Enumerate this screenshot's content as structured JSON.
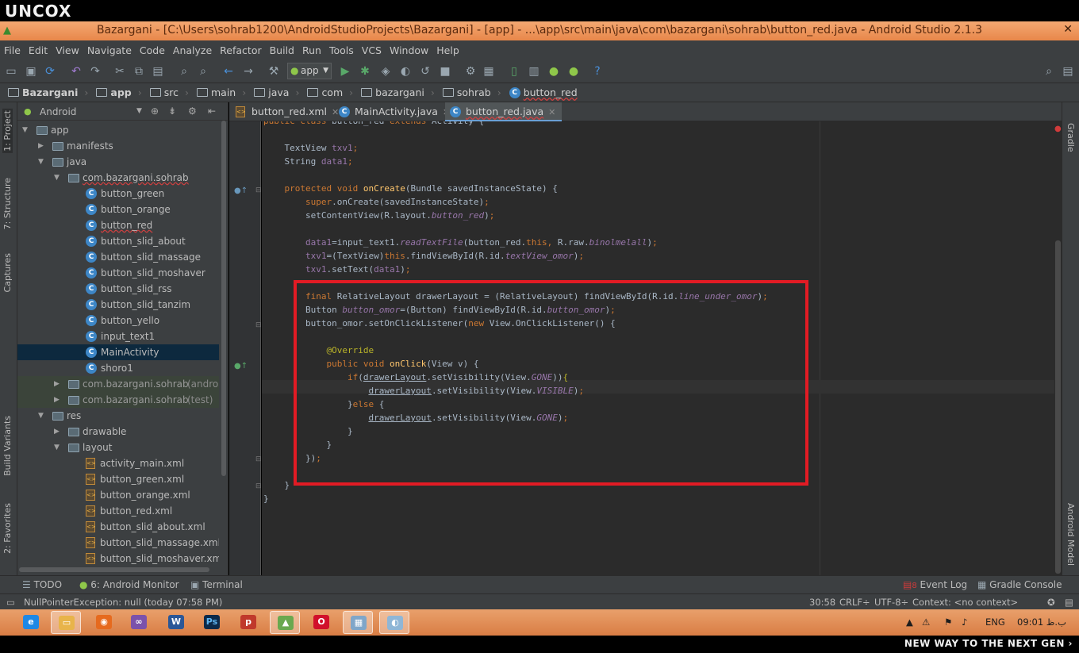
{
  "brand": {
    "logo": "UNCOX",
    "slogan": "NEW WAY TO THE NEXT GEN ›"
  },
  "window": {
    "title": "Bazargani - [C:\\Users\\sohrab1200\\AndroidStudioProjects\\Bazargani] - [app] - ...\\app\\src\\main\\java\\com\\bazargani\\sohrab\\button_red.java - Android Studio 2.1.3",
    "close": "✕"
  },
  "menu": [
    "File",
    "Edit",
    "View",
    "Navigate",
    "Code",
    "Analyze",
    "Refactor",
    "Build",
    "Run",
    "Tools",
    "VCS",
    "Window",
    "Help"
  ],
  "toolbar": {
    "run_config": "app"
  },
  "breadcrumbs": [
    "Bazargani",
    "app",
    "src",
    "main",
    "java",
    "com",
    "bazargani",
    "sohrab",
    "button_red"
  ],
  "left_stripe": {
    "project": "1: Project",
    "structure": "7: Structure",
    "captures": "Captures",
    "build_variants": "Build Variants",
    "favorites": "2: Favorites"
  },
  "right_stripe": {
    "gradle": "Gradle",
    "android_model": "Android Model"
  },
  "project_panel": {
    "view_mode": "Android",
    "tree": [
      {
        "label": "app",
        "type": "module",
        "indent": 0,
        "expanded": true
      },
      {
        "label": "manifests",
        "type": "folder",
        "indent": 1,
        "expanded": false
      },
      {
        "label": "java",
        "type": "folder",
        "indent": 1,
        "expanded": true
      },
      {
        "label": "com.bazargani.sohrab",
        "type": "package",
        "indent": 2,
        "expanded": true,
        "error": true
      },
      {
        "label": "button_green",
        "type": "class",
        "indent": 3
      },
      {
        "label": "button_orange",
        "type": "class",
        "indent": 3
      },
      {
        "label": "button_red",
        "type": "class",
        "indent": 3,
        "error": true
      },
      {
        "label": "button_slid_about",
        "type": "class",
        "indent": 3
      },
      {
        "label": "button_slid_massage",
        "type": "class",
        "indent": 3
      },
      {
        "label": "button_slid_moshaver",
        "type": "class",
        "indent": 3
      },
      {
        "label": "button_slid_rss",
        "type": "class",
        "indent": 3
      },
      {
        "label": "button_slid_tanzim",
        "type": "class",
        "indent": 3
      },
      {
        "label": "button_yello",
        "type": "class",
        "indent": 3
      },
      {
        "label": "input_text1",
        "type": "class",
        "indent": 3
      },
      {
        "label": "MainActivity",
        "type": "class",
        "indent": 3,
        "selected": true
      },
      {
        "label": "shoro1",
        "type": "class",
        "indent": 3
      },
      {
        "label": "com.bazargani.sohrab",
        "suffix": "(androidT",
        "type": "package",
        "indent": 2,
        "expanded": false,
        "gray": true
      },
      {
        "label": "com.bazargani.sohrab",
        "suffix": "(test)",
        "type": "package",
        "indent": 2,
        "expanded": false,
        "gray": true
      },
      {
        "label": "res",
        "type": "folder",
        "indent": 1,
        "expanded": true
      },
      {
        "label": "drawable",
        "type": "folder",
        "indent": 2,
        "expanded": false
      },
      {
        "label": "layout",
        "type": "folder",
        "indent": 2,
        "expanded": true
      },
      {
        "label": "activity_main.xml",
        "type": "xml",
        "indent": 3
      },
      {
        "label": "button_green.xml",
        "type": "xml",
        "indent": 3
      },
      {
        "label": "button_orange.xml",
        "type": "xml",
        "indent": 3
      },
      {
        "label": "button_red.xml",
        "type": "xml",
        "indent": 3
      },
      {
        "label": "button_slid_about.xml",
        "type": "xml",
        "indent": 3
      },
      {
        "label": "button_slid_massage.xml",
        "type": "xml",
        "indent": 3
      },
      {
        "label": "button_slid_moshaver.xml",
        "type": "xml",
        "indent": 3
      }
    ]
  },
  "editor_tabs": [
    {
      "label": "button_red.xml",
      "type": "xml",
      "active": false
    },
    {
      "label": "MainActivity.java",
      "type": "class",
      "active": false
    },
    {
      "label": "button_red.java",
      "type": "class",
      "active": true,
      "error": true
    }
  ],
  "code_lines": [
    {
      "line": "public class button_red extends Activity {",
      "spans": [
        [
          "kw",
          "public class "
        ],
        [
          "",
          "button_red "
        ],
        [
          "kw",
          "extends "
        ],
        [
          "",
          "Activity {"
        ]
      ]
    },
    {
      "spans": [
        [
          "",
          ""
        ]
      ]
    },
    {
      "spans": [
        [
          "",
          "    TextView "
        ],
        [
          "fd",
          "txv1"
        ],
        [
          "kw",
          ";"
        ]
      ]
    },
    {
      "spans": [
        [
          "",
          "    String "
        ],
        [
          "fd",
          "data1"
        ],
        [
          "kw",
          ";"
        ]
      ]
    },
    {
      "spans": [
        [
          "",
          ""
        ]
      ]
    },
    {
      "spans": [
        [
          "kw",
          "    protected void "
        ],
        [
          "fn",
          "onCreate"
        ],
        [
          "",
          "(Bundle savedInstanceState) {"
        ]
      ]
    },
    {
      "spans": [
        [
          "kw",
          "        super"
        ],
        [
          "",
          ".onCreate(savedInstanceState)"
        ],
        [
          "kw",
          ";"
        ]
      ]
    },
    {
      "spans": [
        [
          "",
          "        setContentView(R.layout."
        ],
        [
          "it",
          "button_red"
        ],
        [
          "",
          ")"
        ],
        [
          "kw",
          ";"
        ]
      ]
    },
    {
      "spans": [
        [
          "",
          ""
        ]
      ]
    },
    {
      "spans": [
        [
          "fd",
          "        data1"
        ],
        [
          "",
          "=input_text1."
        ],
        [
          "it",
          "readTextFile"
        ],
        [
          "",
          "(button_red."
        ],
        [
          "kw",
          "this, "
        ],
        [
          "",
          "R.raw."
        ],
        [
          "it",
          "binolmelall"
        ],
        [
          "",
          ")"
        ],
        [
          "kw",
          ";"
        ]
      ]
    },
    {
      "spans": [
        [
          "fd",
          "        txv1"
        ],
        [
          "",
          "=(TextView)"
        ],
        [
          "kw",
          "this"
        ],
        [
          "",
          ".findViewById(R.id."
        ],
        [
          "it",
          "textView_omor"
        ],
        [
          "",
          ")"
        ],
        [
          "kw",
          ";"
        ]
      ]
    },
    {
      "spans": [
        [
          "fd",
          "        txv1"
        ],
        [
          "",
          ".setText("
        ],
        [
          "fd",
          "data1"
        ],
        [
          "",
          ")"
        ],
        [
          "kw",
          ";"
        ]
      ]
    },
    {
      "spans": [
        [
          "",
          ""
        ]
      ]
    },
    {
      "spans": [
        [
          "kw",
          "        final "
        ],
        [
          "",
          "RelativeLayout drawerLayout = (RelativeLayout) findViewById(R.id."
        ],
        [
          "it",
          "line_under_omor"
        ],
        [
          "",
          ")"
        ],
        [
          "kw",
          ";"
        ]
      ]
    },
    {
      "spans": [
        [
          "",
          "        Button "
        ],
        [
          "it",
          "button_omor"
        ],
        [
          "",
          "=(Button) findViewById(R.id."
        ],
        [
          "it",
          "button_omor"
        ],
        [
          "",
          ")"
        ],
        [
          "kw",
          ";"
        ]
      ]
    },
    {
      "spans": [
        [
          "",
          "        button_omor.setOnClickListener("
        ],
        [
          "kw",
          "new "
        ],
        [
          "",
          "View.OnClickListener() {"
        ]
      ]
    },
    {
      "spans": [
        [
          "",
          ""
        ]
      ]
    },
    {
      "spans": [
        [
          "an",
          "            @Override"
        ]
      ]
    },
    {
      "spans": [
        [
          "kw",
          "            public void "
        ],
        [
          "fn",
          "onClick"
        ],
        [
          "",
          "(View v) {"
        ]
      ]
    },
    {
      "spans": [
        [
          "kw",
          "                if"
        ],
        [
          "",
          "("
        ],
        [
          "ul",
          "drawerLayout"
        ],
        [
          "",
          ".setVisibility(View."
        ],
        [
          "it",
          "GONE"
        ],
        [
          "",
          "))"
        ],
        [
          "an",
          "{"
        ]
      ]
    },
    {
      "spans": [
        [
          "",
          "                    "
        ],
        [
          "ul",
          "drawerLayout"
        ],
        [
          "",
          ".setVisibility(View."
        ],
        [
          "it",
          "VISIBLE"
        ],
        [
          "",
          ")"
        ],
        [
          "kw",
          ";"
        ]
      ]
    },
    {
      "spans": [
        [
          "",
          "                }"
        ],
        [
          "kw",
          "else "
        ],
        [
          "",
          "{"
        ]
      ]
    },
    {
      "spans": [
        [
          "",
          "                    "
        ],
        [
          "ul",
          "drawerLayout"
        ],
        [
          "",
          ".setVisibility(View."
        ],
        [
          "it",
          "GONE"
        ],
        [
          "",
          ")"
        ],
        [
          "kw",
          ";"
        ]
      ]
    },
    {
      "spans": [
        [
          "",
          "                }"
        ]
      ]
    },
    {
      "spans": [
        [
          "",
          "            }"
        ]
      ]
    },
    {
      "spans": [
        [
          "",
          "        })"
        ],
        [
          "kw",
          ";"
        ]
      ]
    },
    {
      "spans": [
        [
          "",
          ""
        ]
      ]
    },
    {
      "spans": [
        [
          "",
          "    }"
        ]
      ]
    },
    {
      "spans": [
        [
          "",
          "}"
        ]
      ]
    }
  ],
  "bottom_tools": {
    "todo": "TODO",
    "android_monitor": "6: Android Monitor",
    "terminal": "Terminal",
    "event_log": "Event Log",
    "event_count": "8",
    "gradle_console": "Gradle Console"
  },
  "status": {
    "message": "NullPointerException: null (today 07:58 PM)",
    "position": "30:58",
    "line_sep": "CRLF÷",
    "encoding": "UTF-8÷",
    "context": "Context: <no context>"
  },
  "taskbar": {
    "language": "ENG",
    "clock": "09:01 ب.ظ"
  },
  "colors": {
    "highlight_box": "#e21b24",
    "title_bar": "#e8874a",
    "editor_bg": "#2b2b2b"
  }
}
